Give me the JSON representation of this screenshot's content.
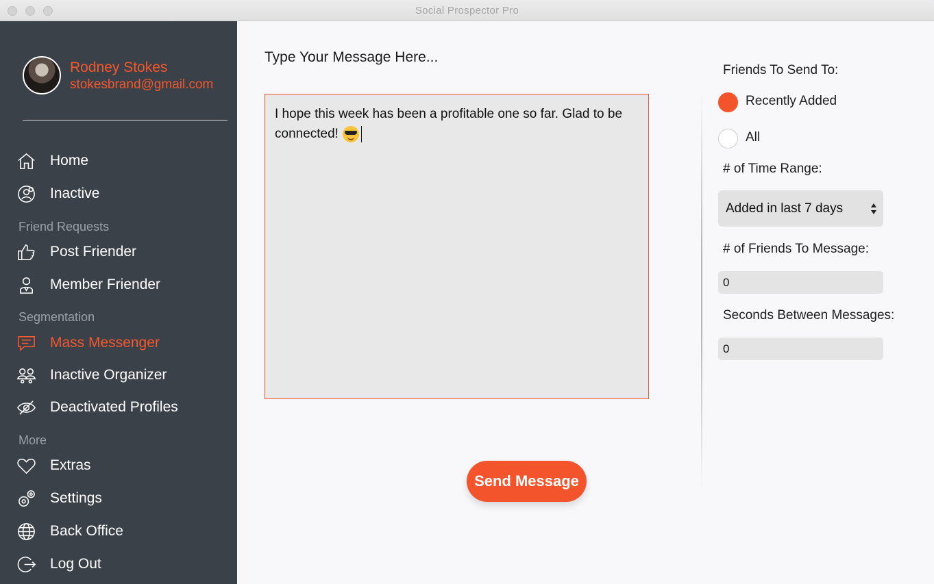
{
  "window": {
    "title": "Social Prospector Pro"
  },
  "user": {
    "name": "Rodney Stokes",
    "email": "stokesbrand@gmail.com"
  },
  "sidebar": {
    "items": [
      {
        "label": "Home",
        "icon": "home-icon"
      },
      {
        "label": "Inactive",
        "icon": "inactive-user-icon"
      },
      {
        "label": "Post Friender",
        "icon": "thumbs-up-icon"
      },
      {
        "label": "Member Friender",
        "icon": "member-icon"
      },
      {
        "label": "Mass Messenger",
        "icon": "message-icon",
        "active": true
      },
      {
        "label": "Inactive Organizer",
        "icon": "group-icon"
      },
      {
        "label": "Deactivated Profiles",
        "icon": "eye-slash-icon"
      },
      {
        "label": "Extras",
        "icon": "heart-icon"
      },
      {
        "label": "Settings",
        "icon": "gears-icon"
      },
      {
        "label": "Back Office",
        "icon": "globe-icon"
      },
      {
        "label": "Log Out",
        "icon": "logout-icon"
      }
    ],
    "sections": [
      "Friend Requests",
      "Segmentation",
      "More"
    ]
  },
  "main": {
    "title": "Type Your Message Here...",
    "message": "I hope this week has been a profitable one so far. Glad to be connected!",
    "message_emoji": "sunglasses-emoji",
    "send_label": "Send Message"
  },
  "options": {
    "friends_label": "Friends To Send To:",
    "radio_recent": "Recently Added",
    "radio_all": "All",
    "selected": "Recently Added",
    "time_range_label": "# of Time Range:",
    "time_range_value": "Added in last 7 days",
    "friends_count_label": "# of Friends To Message:",
    "friends_count_value": "0",
    "seconds_label": "Seconds Between Messages:",
    "seconds_value": "0"
  },
  "colors": {
    "accent": "#f3542b",
    "sidebar": "#3b4149",
    "background": "#f8f8fa"
  }
}
